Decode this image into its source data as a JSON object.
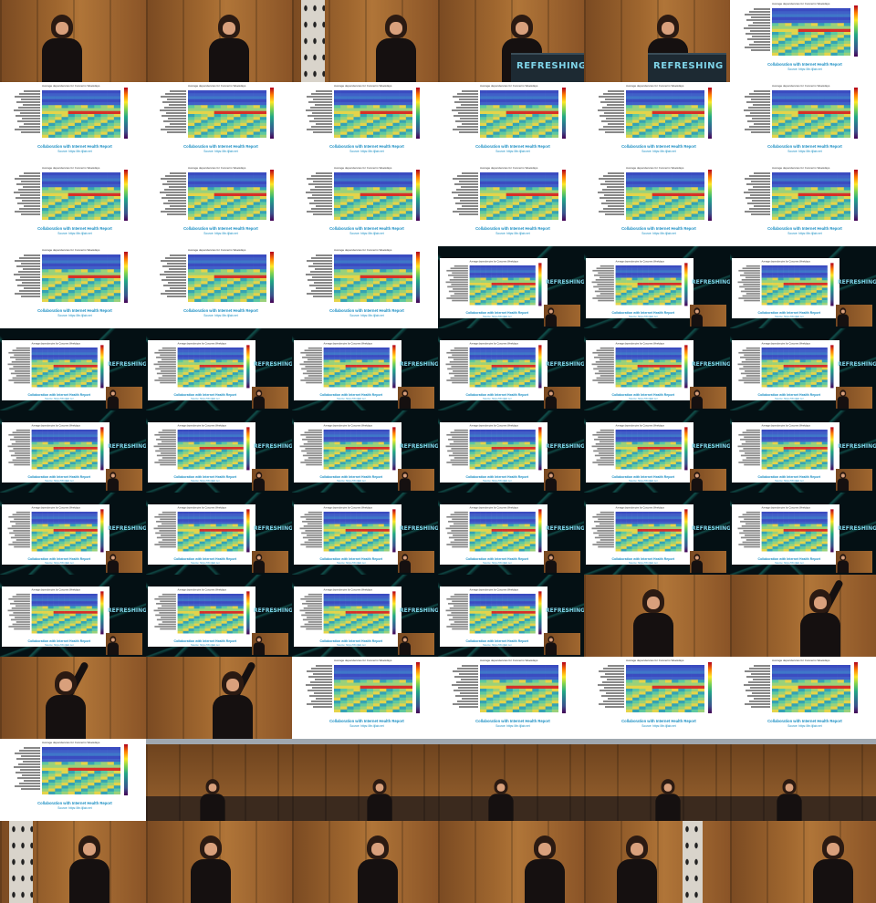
{
  "grid": {
    "columns": 6,
    "rows": 11
  },
  "slide": {
    "chart_title": "Average dependencies for Concerns Weekdays",
    "caption": "Collaboration with Internet Health Report",
    "source": "Source: https://ihr.iijlab.net"
  },
  "branding": {
    "podium_text": "REFRESHING",
    "logo_text": "REFRESHING"
  },
  "tiles": [
    "speaker",
    "speaker",
    "speaker-pillar",
    "podium",
    "podium",
    "slide",
    "slide",
    "slide",
    "slide",
    "slide",
    "slide",
    "slide",
    "slide",
    "slide",
    "slide",
    "slide",
    "slide",
    "slide",
    "slide",
    "slide",
    "slide",
    "combo",
    "combo",
    "combo",
    "combo",
    "combo",
    "combo",
    "combo",
    "combo",
    "combo",
    "combo",
    "combo",
    "combo",
    "combo",
    "combo",
    "combo",
    "combo",
    "combo",
    "combo",
    "combo",
    "combo",
    "combo",
    "combo",
    "combo",
    "combo",
    "combo",
    "speaker-close",
    "speaker-armup",
    "speaker-armup",
    "speaker-armup",
    "slide",
    "slide",
    "slide",
    "slide",
    "slide",
    "stage",
    "stage",
    "stage",
    "stage",
    "stage",
    "speaker-pillar",
    "speaker",
    "speaker",
    "speaker",
    "speaker-pillar-right",
    "speaker"
  ]
}
